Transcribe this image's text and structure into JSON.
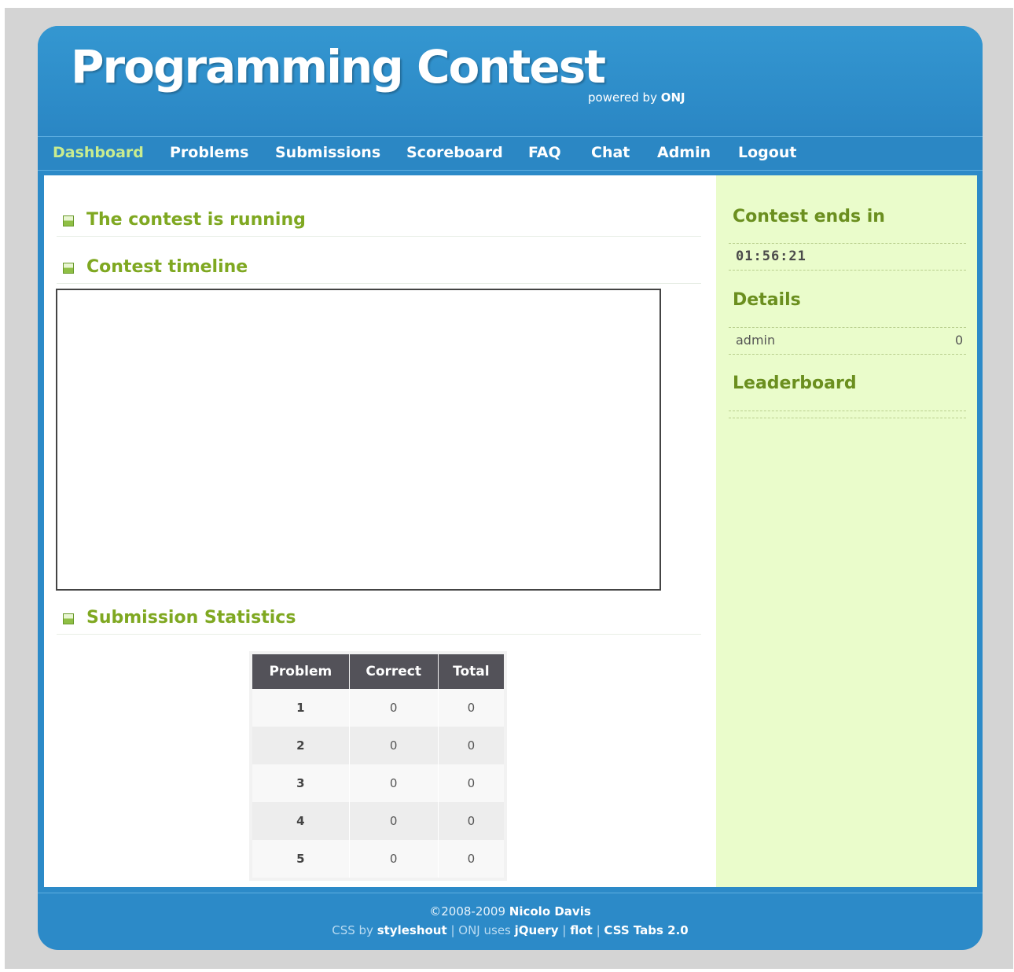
{
  "header": {
    "title": "Programming Contest",
    "powered_prefix": "powered by",
    "powered_brand": "ONJ"
  },
  "nav": {
    "items": [
      "Dashboard",
      "Problems",
      "Submissions",
      "Scoreboard",
      "FAQ",
      "Chat",
      "Admin",
      "Logout"
    ],
    "active": "Dashboard"
  },
  "main": {
    "status_heading": "The contest is running",
    "timeline_heading": "Contest timeline",
    "stats_heading": "Submission Statistics",
    "stats_table": {
      "columns": [
        "Problem",
        "Correct",
        "Total"
      ],
      "rows": [
        [
          "1",
          "0",
          "0"
        ],
        [
          "2",
          "0",
          "0"
        ],
        [
          "3",
          "0",
          "0"
        ],
        [
          "4",
          "0",
          "0"
        ],
        [
          "5",
          "0",
          "0"
        ]
      ]
    }
  },
  "sidebar": {
    "countdown_heading": "Contest ends in",
    "countdown_value": "01:56:21",
    "details_heading": "Details",
    "details_user": "admin",
    "details_score": "0",
    "leaderboard_heading": "Leaderboard"
  },
  "footer": {
    "copyright": "©2008-2009",
    "author": "Nicolo Davis",
    "css_by": "CSS by",
    "css_link": "styleshout",
    "sep": "|",
    "onj_uses": "ONJ uses",
    "link_jquery": "jQuery",
    "link_flot": "flot",
    "link_csstabs": "CSS Tabs 2.0"
  },
  "colors": {
    "header_blue": "#2c8ac8",
    "nav_active": "#c9ec8f",
    "heading_green": "#7fa821",
    "sidebar_bg": "#eafccb",
    "table_header": "#535259"
  }
}
